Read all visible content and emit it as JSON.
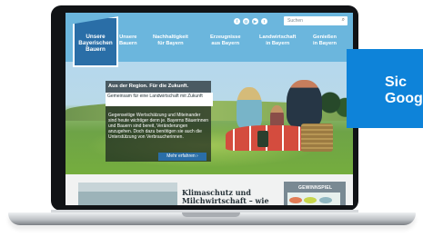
{
  "logo": {
    "lines": [
      "Unsere",
      "Bayerischen",
      "Bauern"
    ]
  },
  "nav": {
    "items": [
      {
        "line1": "Unsere",
        "line2": "Bauern"
      },
      {
        "line1": "Nachhaltigkeit",
        "line2": "für Bayern"
      },
      {
        "line1": "Erzeugnisse",
        "line2": "aus Bayern"
      },
      {
        "line1": "Landwirtschaft",
        "line2": "in Bayern"
      },
      {
        "line1": "Genießen",
        "line2": "in Bayern"
      }
    ]
  },
  "header": {
    "social_icons": [
      "facebook-icon",
      "instagram-icon",
      "youtube-icon",
      "twitter-icon"
    ],
    "social_glyphs": [
      "f",
      "◎",
      "▶",
      "t"
    ],
    "search_placeholder": "Suchen",
    "search_glyph": "⌕"
  },
  "hero": {
    "title": "Aus der Region. Für die Zukunft.",
    "subtitle": "Gemeinsam für eine Landwirtschaft mit Zukunft",
    "body": "Gegenseitige Wertschätzung und Miteinander sind heute wichtiger denn je. Bayerns Bäuerinnen und Bauern sind bereit, Veränderungen anzugehen. Doch dazu benötigen sie auch die Unterstützung von Verbraucherinnen.",
    "cta": "Mehr erfahren ›"
  },
  "article": {
    "title_line1": "Klimaschutz und",
    "title_line2": "Milchwirtschaft – wie"
  },
  "contest": {
    "label": "GEWINNSPIEL"
  },
  "popup": {
    "text_line1": "Sic",
    "text_line2": "Goog"
  }
}
